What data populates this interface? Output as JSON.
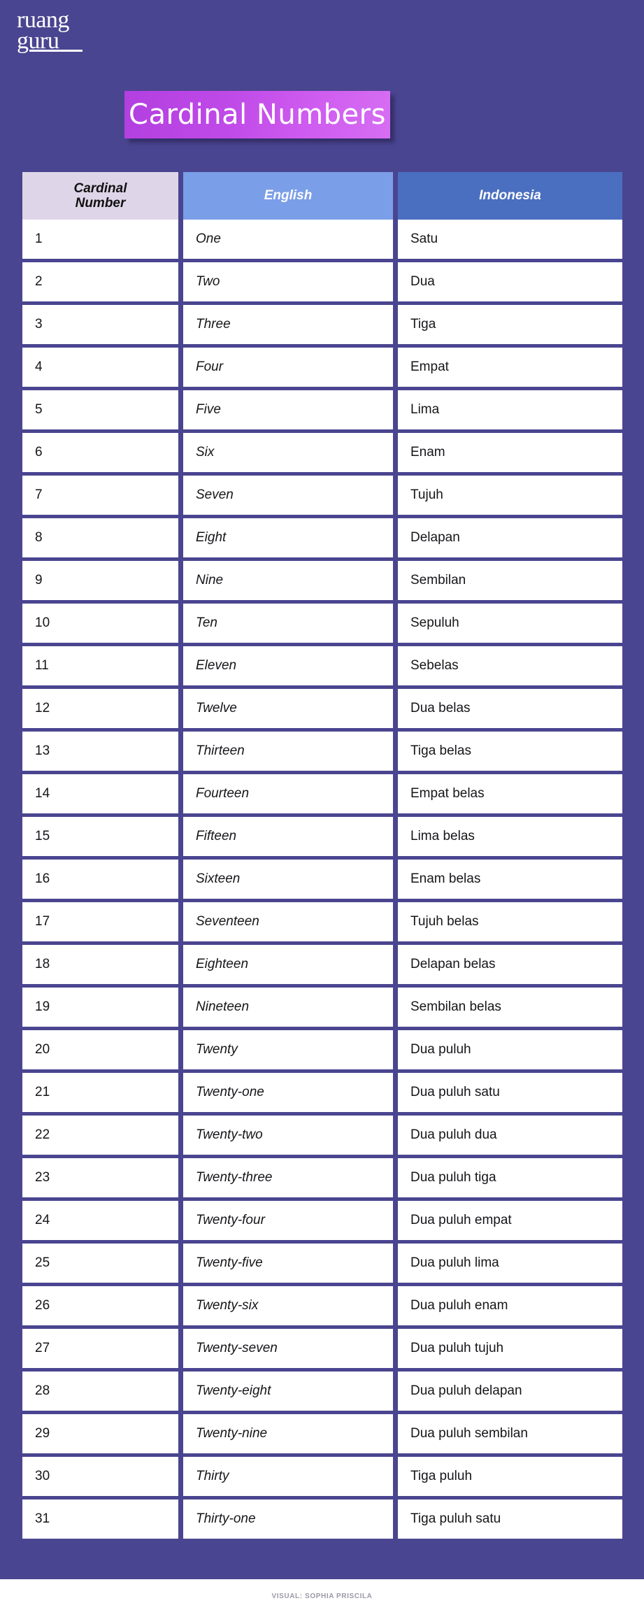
{
  "brand": {
    "logo_line1": "ruang",
    "logo_line2": "guru"
  },
  "title": {
    "text": "Cardinal Numbers",
    "banner_color_start": "#b23fe0",
    "banner_color_end": "#d66ef2"
  },
  "colors": {
    "background": "#4a4590",
    "header_col1": "#ded6e8",
    "header_col2": "#7b9ee8",
    "header_col3": "#4a6fc0",
    "cell_background": "#ffffff",
    "cell_text": "#16161a"
  },
  "table": {
    "headers": [
      "Cardinal Number",
      "English",
      "Indonesia"
    ],
    "header_col1_line1": "Cardinal",
    "header_col1_line2": "Number",
    "rows": [
      {
        "number": "1",
        "english": "One",
        "indonesia": "Satu"
      },
      {
        "number": "2",
        "english": "Two",
        "indonesia": "Dua"
      },
      {
        "number": "3",
        "english": "Three",
        "indonesia": "Tiga"
      },
      {
        "number": "4",
        "english": "Four",
        "indonesia": "Empat"
      },
      {
        "number": "5",
        "english": "Five",
        "indonesia": "Lima"
      },
      {
        "number": "6",
        "english": "Six",
        "indonesia": "Enam"
      },
      {
        "number": "7",
        "english": "Seven",
        "indonesia": "Tujuh"
      },
      {
        "number": "8",
        "english": "Eight",
        "indonesia": "Delapan"
      },
      {
        "number": "9",
        "english": "Nine",
        "indonesia": "Sembilan"
      },
      {
        "number": "10",
        "english": "Ten",
        "indonesia": "Sepuluh"
      },
      {
        "number": "11",
        "english": "Eleven",
        "indonesia": "Sebelas"
      },
      {
        "number": "12",
        "english": "Twelve",
        "indonesia": "Dua belas"
      },
      {
        "number": "13",
        "english": "Thirteen",
        "indonesia": "Tiga belas"
      },
      {
        "number": "14",
        "english": "Fourteen",
        "indonesia": "Empat belas"
      },
      {
        "number": "15",
        "english": "Fifteen",
        "indonesia": "Lima belas"
      },
      {
        "number": "16",
        "english": "Sixteen",
        "indonesia": "Enam belas"
      },
      {
        "number": "17",
        "english": "Seventeen",
        "indonesia": "Tujuh belas"
      },
      {
        "number": "18",
        "english": "Eighteen",
        "indonesia": "Delapan belas"
      },
      {
        "number": "19",
        "english": "Nineteen",
        "indonesia": "Sembilan belas"
      },
      {
        "number": "20",
        "english": "Twenty",
        "indonesia": "Dua puluh"
      },
      {
        "number": "21",
        "english": "Twenty-one",
        "indonesia": "Dua puluh satu"
      },
      {
        "number": "22",
        "english": "Twenty-two",
        "indonesia": "Dua puluh dua"
      },
      {
        "number": "23",
        "english": "Twenty-three",
        "indonesia": "Dua puluh tiga"
      },
      {
        "number": "24",
        "english": "Twenty-four",
        "indonesia": "Dua puluh empat"
      },
      {
        "number": "25",
        "english": "Twenty-five",
        "indonesia": "Dua puluh lima"
      },
      {
        "number": "26",
        "english": "Twenty-six",
        "indonesia": "Dua puluh enam"
      },
      {
        "number": "27",
        "english": "Twenty-seven",
        "indonesia": "Dua puluh tujuh"
      },
      {
        "number": "28",
        "english": "Twenty-eight",
        "indonesia": "Dua puluh delapan"
      },
      {
        "number": "29",
        "english": "Twenty-nine",
        "indonesia": "Dua puluh sembilan"
      },
      {
        "number": "30",
        "english": "Thirty",
        "indonesia": "Tiga puluh"
      },
      {
        "number": "31",
        "english": "Thirty-one",
        "indonesia": "Tiga puluh satu"
      }
    ]
  },
  "footer": {
    "credit": "VISUAL: SOPHIA PRISCILA"
  }
}
